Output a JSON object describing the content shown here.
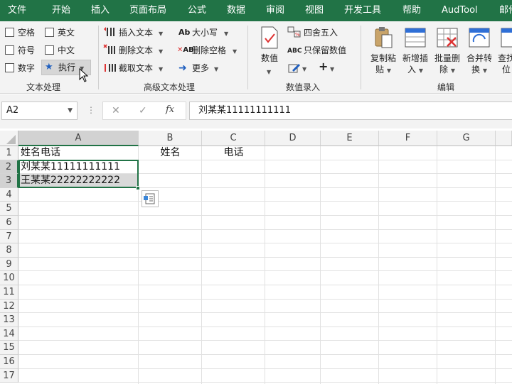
{
  "menu": {
    "tabs": [
      "文件",
      "开始",
      "插入",
      "页面布局",
      "公式",
      "数据",
      "审阅",
      "视图",
      "开发工具",
      "帮助",
      "AudTool",
      "邮件"
    ]
  },
  "ribbon": {
    "text_processing": {
      "label": "文本处理",
      "checks": [
        "空格",
        "英文",
        "符号",
        "中文",
        "数字"
      ],
      "execute": "执行"
    },
    "advanced_text": {
      "label": "高级文本处理",
      "insert": "插入文本",
      "delete": "删除文本",
      "extract": "截取文本",
      "case": "大小写",
      "delete_space": "删除空格",
      "more": "更多"
    },
    "number_entry": {
      "label": "数值录入",
      "numeric": "数值",
      "round": "四舍五入",
      "keep_numeric": "只保留数值"
    },
    "edit": {
      "label": "编辑",
      "copy_paste": [
        "复制粘",
        "贴"
      ],
      "add_insert": [
        "新增插",
        "入"
      ],
      "batch_delete": [
        "批量删",
        "除"
      ],
      "merge_convert": [
        "合并转",
        "换"
      ],
      "lookup": [
        "查找",
        "位"
      ]
    }
  },
  "formula_bar": {
    "name_box": "A2",
    "formula": "刘某某11111111111"
  },
  "sheet": {
    "columns": [
      "A",
      "B",
      "C",
      "D",
      "E",
      "F",
      "G"
    ],
    "rows": [
      "1",
      "2",
      "3",
      "4",
      "5",
      "6",
      "7",
      "8",
      "9",
      "10",
      "11",
      "12",
      "13",
      "14",
      "15",
      "16",
      "17"
    ],
    "cells": {
      "A1": "姓名电话",
      "B1": "姓名",
      "C1": "电话",
      "A2": "刘某某11111111111",
      "A3": "王某某22222222222"
    }
  },
  "colors": {
    "accent": "#217346",
    "selection_border": "#217346",
    "selected_header": "#d2d2d2"
  }
}
